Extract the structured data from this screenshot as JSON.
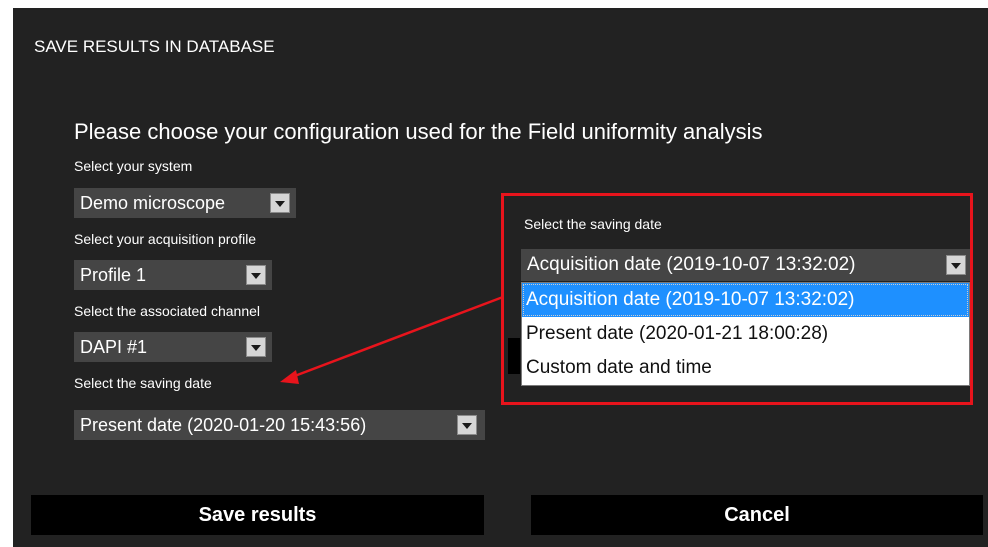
{
  "dialog": {
    "title": "SAVE RESULTS IN DATABASE",
    "heading": "Please choose your configuration used for the Field uniformity analysis",
    "system": {
      "label": "Select your system",
      "value": "Demo microscope"
    },
    "profile": {
      "label": "Select your acquisition profile",
      "value": "Profile 1"
    },
    "channel": {
      "label": "Select the associated channel",
      "value": "DAPI #1"
    },
    "saving_date": {
      "label": "Select the saving date",
      "value": "Present date (2020-01-20 15:43:56)"
    },
    "buttons": {
      "save": "Save results",
      "cancel": "Cancel"
    }
  },
  "zoom_popup": {
    "label": "Select the saving date",
    "value": "Acquisition date (2019-10-07 13:32:02)",
    "options": [
      "Acquisition date (2019-10-07 13:32:02)",
      "Present date (2020-01-21 18:00:28)",
      "Custom date and time"
    ],
    "selected_index": 0
  },
  "colors": {
    "highlight_border": "#e8141c",
    "arrow": "#e8141c",
    "selected_bg": "#1e90ff",
    "dialog_bg": "#222222"
  },
  "icons": {
    "dropdown": "chevron-down-icon",
    "callout_arrow": "arrow-icon"
  }
}
